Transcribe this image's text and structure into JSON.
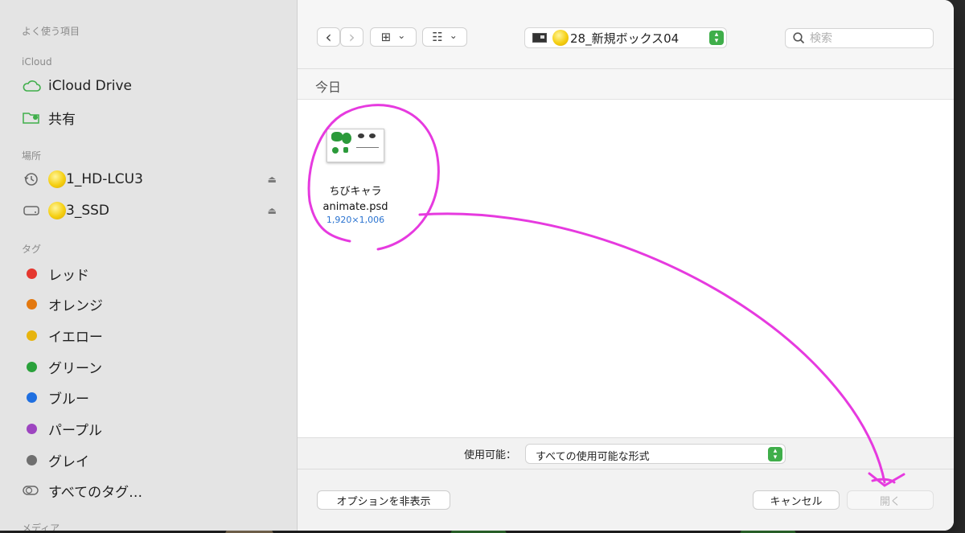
{
  "sidebar": {
    "favorites_header": "よく使う項目",
    "icloud_header": "iCloud",
    "icloud_items": [
      {
        "label": "iCloud Drive",
        "icon": "cloud-icon"
      },
      {
        "label": "共有",
        "icon": "shared-folder-icon"
      }
    ],
    "locations_header": "場所",
    "locations": [
      {
        "label": "1_HD-LCU3",
        "icon": "time-machine-icon",
        "eject": "⏏"
      },
      {
        "label": "3_SSD",
        "icon": "drive-icon",
        "eject": "⏏"
      }
    ],
    "tags_header": "タグ",
    "tags": [
      {
        "label": "レッド",
        "color": "#e5372f"
      },
      {
        "label": "オレンジ",
        "color": "#e3780f"
      },
      {
        "label": "イエロー",
        "color": "#e7b40e"
      },
      {
        "label": "グリーン",
        "color": "#2aa13b"
      },
      {
        "label": "ブルー",
        "color": "#1f6fe0"
      },
      {
        "label": "パープル",
        "color": "#9d45c0"
      },
      {
        "label": "グレイ",
        "color": "#6f6f6f"
      }
    ],
    "all_tags": "すべてのタグ…",
    "media_header": "メディア"
  },
  "toolbar": {
    "back": "‹",
    "forward": "›",
    "icon_view": "⊞",
    "group_view": "☷",
    "chevron": "⌄",
    "path": "28_新規ボックス04",
    "search_placeholder": "検索"
  },
  "group_header": "今日",
  "file": {
    "name_line1": "ちびキャラ",
    "name_line2": "animate.psd",
    "dimensions": "1,920×1,006"
  },
  "format": {
    "label": "使用可能：",
    "value": "すべての使用可能な形式"
  },
  "footer": {
    "options_button": "オプションを非表示",
    "cancel_button": "キャンセル",
    "open_button": "開く"
  },
  "colors": {
    "accent_green": "#3fae4a",
    "annotation": "#e63adf",
    "sidebar_bg": "#e4e4e4"
  }
}
